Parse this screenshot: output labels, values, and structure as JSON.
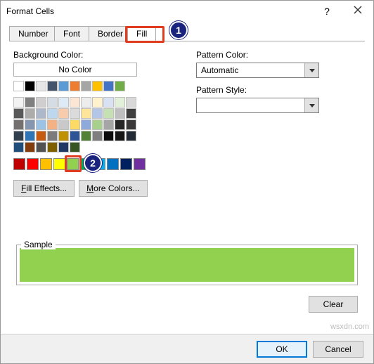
{
  "title": "Format Cells",
  "tabs": {
    "number": "Number",
    "font": "Font",
    "border": "Border",
    "fill": "Fill"
  },
  "labels": {
    "bgcolor": "Background Color:",
    "nocolor": "No Color",
    "patterncolor": "Pattern Color:",
    "patternstyle": "Pattern Style:",
    "automatic": "Automatic",
    "filleffects": "Fill Effects...",
    "morecolors": "More Colors...",
    "sample": "Sample",
    "clear": "Clear",
    "ok": "OK",
    "cancel": "Cancel"
  },
  "callouts": {
    "one": "1",
    "two": "2"
  },
  "theme_colors_row1": [
    "#ffffff",
    "#000000",
    "#e7e6e6",
    "#44546a",
    "#5b9bd5",
    "#ed7d31",
    "#a5a5a5",
    "#ffc000",
    "#4472c4",
    "#70ad47"
  ],
  "theme_shades": [
    [
      "#f2f2f2",
      "#808080",
      "#d0cece",
      "#d6dce4",
      "#deebf6",
      "#fbe5d5",
      "#ededed",
      "#fff2cc",
      "#d9e2f3",
      "#e2efd9"
    ],
    [
      "#d8d8d8",
      "#595959",
      "#aeabab",
      "#adb9ca",
      "#bdd7ee",
      "#f7cbac",
      "#dbdbdb",
      "#fee599",
      "#b4c6e7",
      "#c5e0b3"
    ],
    [
      "#bfbfbf",
      "#3f3f3f",
      "#757070",
      "#8496b0",
      "#9cc3e5",
      "#f4b183",
      "#c9c9c9",
      "#fdd966",
      "#8eaadb",
      "#a8d08d"
    ],
    [
      "#a5a5a5",
      "#262626",
      "#3a3838",
      "#323f4f",
      "#2e75b5",
      "#c55a11",
      "#7b7b7b",
      "#bf9000",
      "#2f5496",
      "#538135"
    ],
    [
      "#7f7f7f",
      "#0c0c0c",
      "#171616",
      "#222a35",
      "#1e4e79",
      "#833c0b",
      "#525252",
      "#7f6000",
      "#1f3864",
      "#375623"
    ]
  ],
  "standard_colors": [
    "#c00000",
    "#ff0000",
    "#ffc000",
    "#ffff00",
    "#92d050",
    "#00b050",
    "#00b0f0",
    "#0070c0",
    "#002060",
    "#7030a0"
  ],
  "selected_color": "#92d050",
  "watermark": "wsxdn.com"
}
